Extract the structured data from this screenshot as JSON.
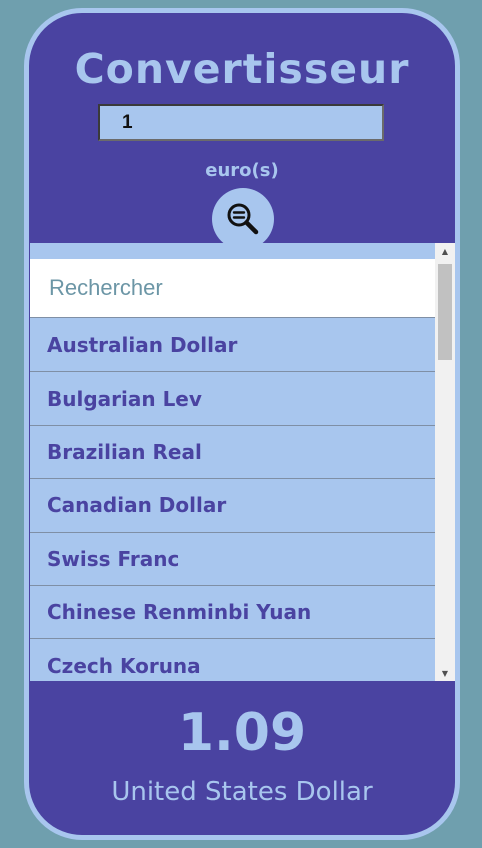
{
  "app": {
    "title": "Convertisseur",
    "amount_value": "1",
    "source_unit": "euro(s)"
  },
  "search": {
    "button_icon": "zoom-search-icon",
    "placeholder": "Rechercher"
  },
  "currencies": [
    "Australian Dollar",
    "Bulgarian Lev",
    "Brazilian Real",
    "Canadian Dollar",
    "Swiss Franc",
    "Chinese Renminbi Yuan",
    "Czech Koruna"
  ],
  "result": {
    "value": "1.09",
    "currency": "United States Dollar"
  },
  "colors": {
    "background": "#6f9fae",
    "primary": "#4a43a1",
    "accent": "#a8c6ee"
  }
}
